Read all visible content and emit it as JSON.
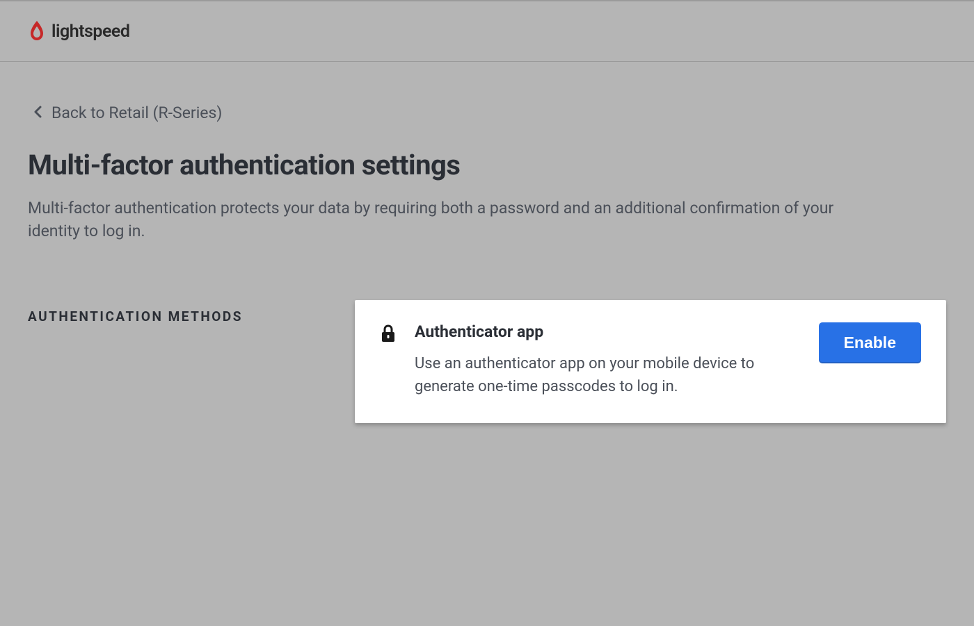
{
  "brand": {
    "name": "lightspeed"
  },
  "backLink": {
    "label": "Back to Retail (R-Series)"
  },
  "page": {
    "title": "Multi-factor authentication settings",
    "description": "Multi-factor authentication protects your data by requiring both a password and an additional confirmation of your identity to log in."
  },
  "section": {
    "label": "AUTHENTICATION METHODS"
  },
  "method": {
    "title": "Authenticator app",
    "description": "Use an authenticator app on your mobile device to generate one-time passcodes to log in.",
    "buttonLabel": "Enable"
  }
}
